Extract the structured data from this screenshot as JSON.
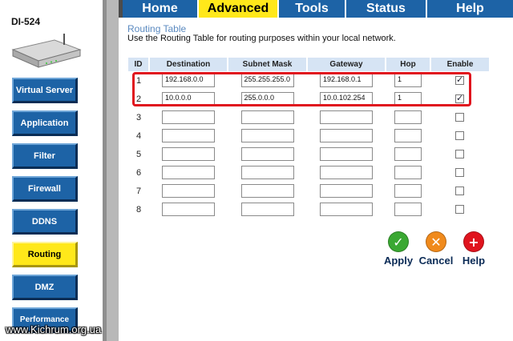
{
  "device": {
    "model": "DI-524"
  },
  "tabs": [
    {
      "label": "Home"
    },
    {
      "label": "Advanced",
      "active": true
    },
    {
      "label": "Tools"
    },
    {
      "label": "Status"
    },
    {
      "label": "Help"
    }
  ],
  "sidebar": {
    "items": [
      {
        "label": "Virtual Server"
      },
      {
        "label": "Application"
      },
      {
        "label": "Filter"
      },
      {
        "label": "Firewall"
      },
      {
        "label": "DDNS"
      },
      {
        "label": "Routing",
        "active": true
      },
      {
        "label": "DMZ"
      },
      {
        "label": "Performance"
      }
    ]
  },
  "section": {
    "title": "Routing Table",
    "description": "Use the Routing Table for routing purposes within your local network."
  },
  "table": {
    "headers": [
      "ID",
      "Destination",
      "Subnet Mask",
      "Gateway",
      "Hop",
      "Enable"
    ],
    "rows": [
      {
        "id": "1",
        "destination": "192.168.0.0",
        "mask": "255.255.255.0",
        "gateway": "192.168.0.1",
        "hop": "1",
        "enabled": true
      },
      {
        "id": "2",
        "destination": "10.0.0.0",
        "mask": "255.0.0.0",
        "gateway": "10.0.102.254",
        "hop": "1",
        "enabled": true
      },
      {
        "id": "3",
        "destination": "",
        "mask": "",
        "gateway": "",
        "hop": "",
        "enabled": false
      },
      {
        "id": "4",
        "destination": "",
        "mask": "",
        "gateway": "",
        "hop": "",
        "enabled": false
      },
      {
        "id": "5",
        "destination": "",
        "mask": "",
        "gateway": "",
        "hop": "",
        "enabled": false
      },
      {
        "id": "6",
        "destination": "",
        "mask": "",
        "gateway": "",
        "hop": "",
        "enabled": false
      },
      {
        "id": "7",
        "destination": "",
        "mask": "",
        "gateway": "",
        "hop": "",
        "enabled": false
      },
      {
        "id": "8",
        "destination": "",
        "mask": "",
        "gateway": "",
        "hop": "",
        "enabled": false
      }
    ]
  },
  "actions": {
    "apply": {
      "label": "Apply",
      "icon": "check-icon",
      "color": "#3aa832"
    },
    "cancel": {
      "label": "Cancel",
      "icon": "cancel-icon",
      "color": "#f08a1c"
    },
    "help": {
      "label": "Help",
      "icon": "plus-icon",
      "color": "#e0141e"
    }
  },
  "highlight_color": "#e0141e",
  "watermark": "www.Kichrum.org.ua"
}
